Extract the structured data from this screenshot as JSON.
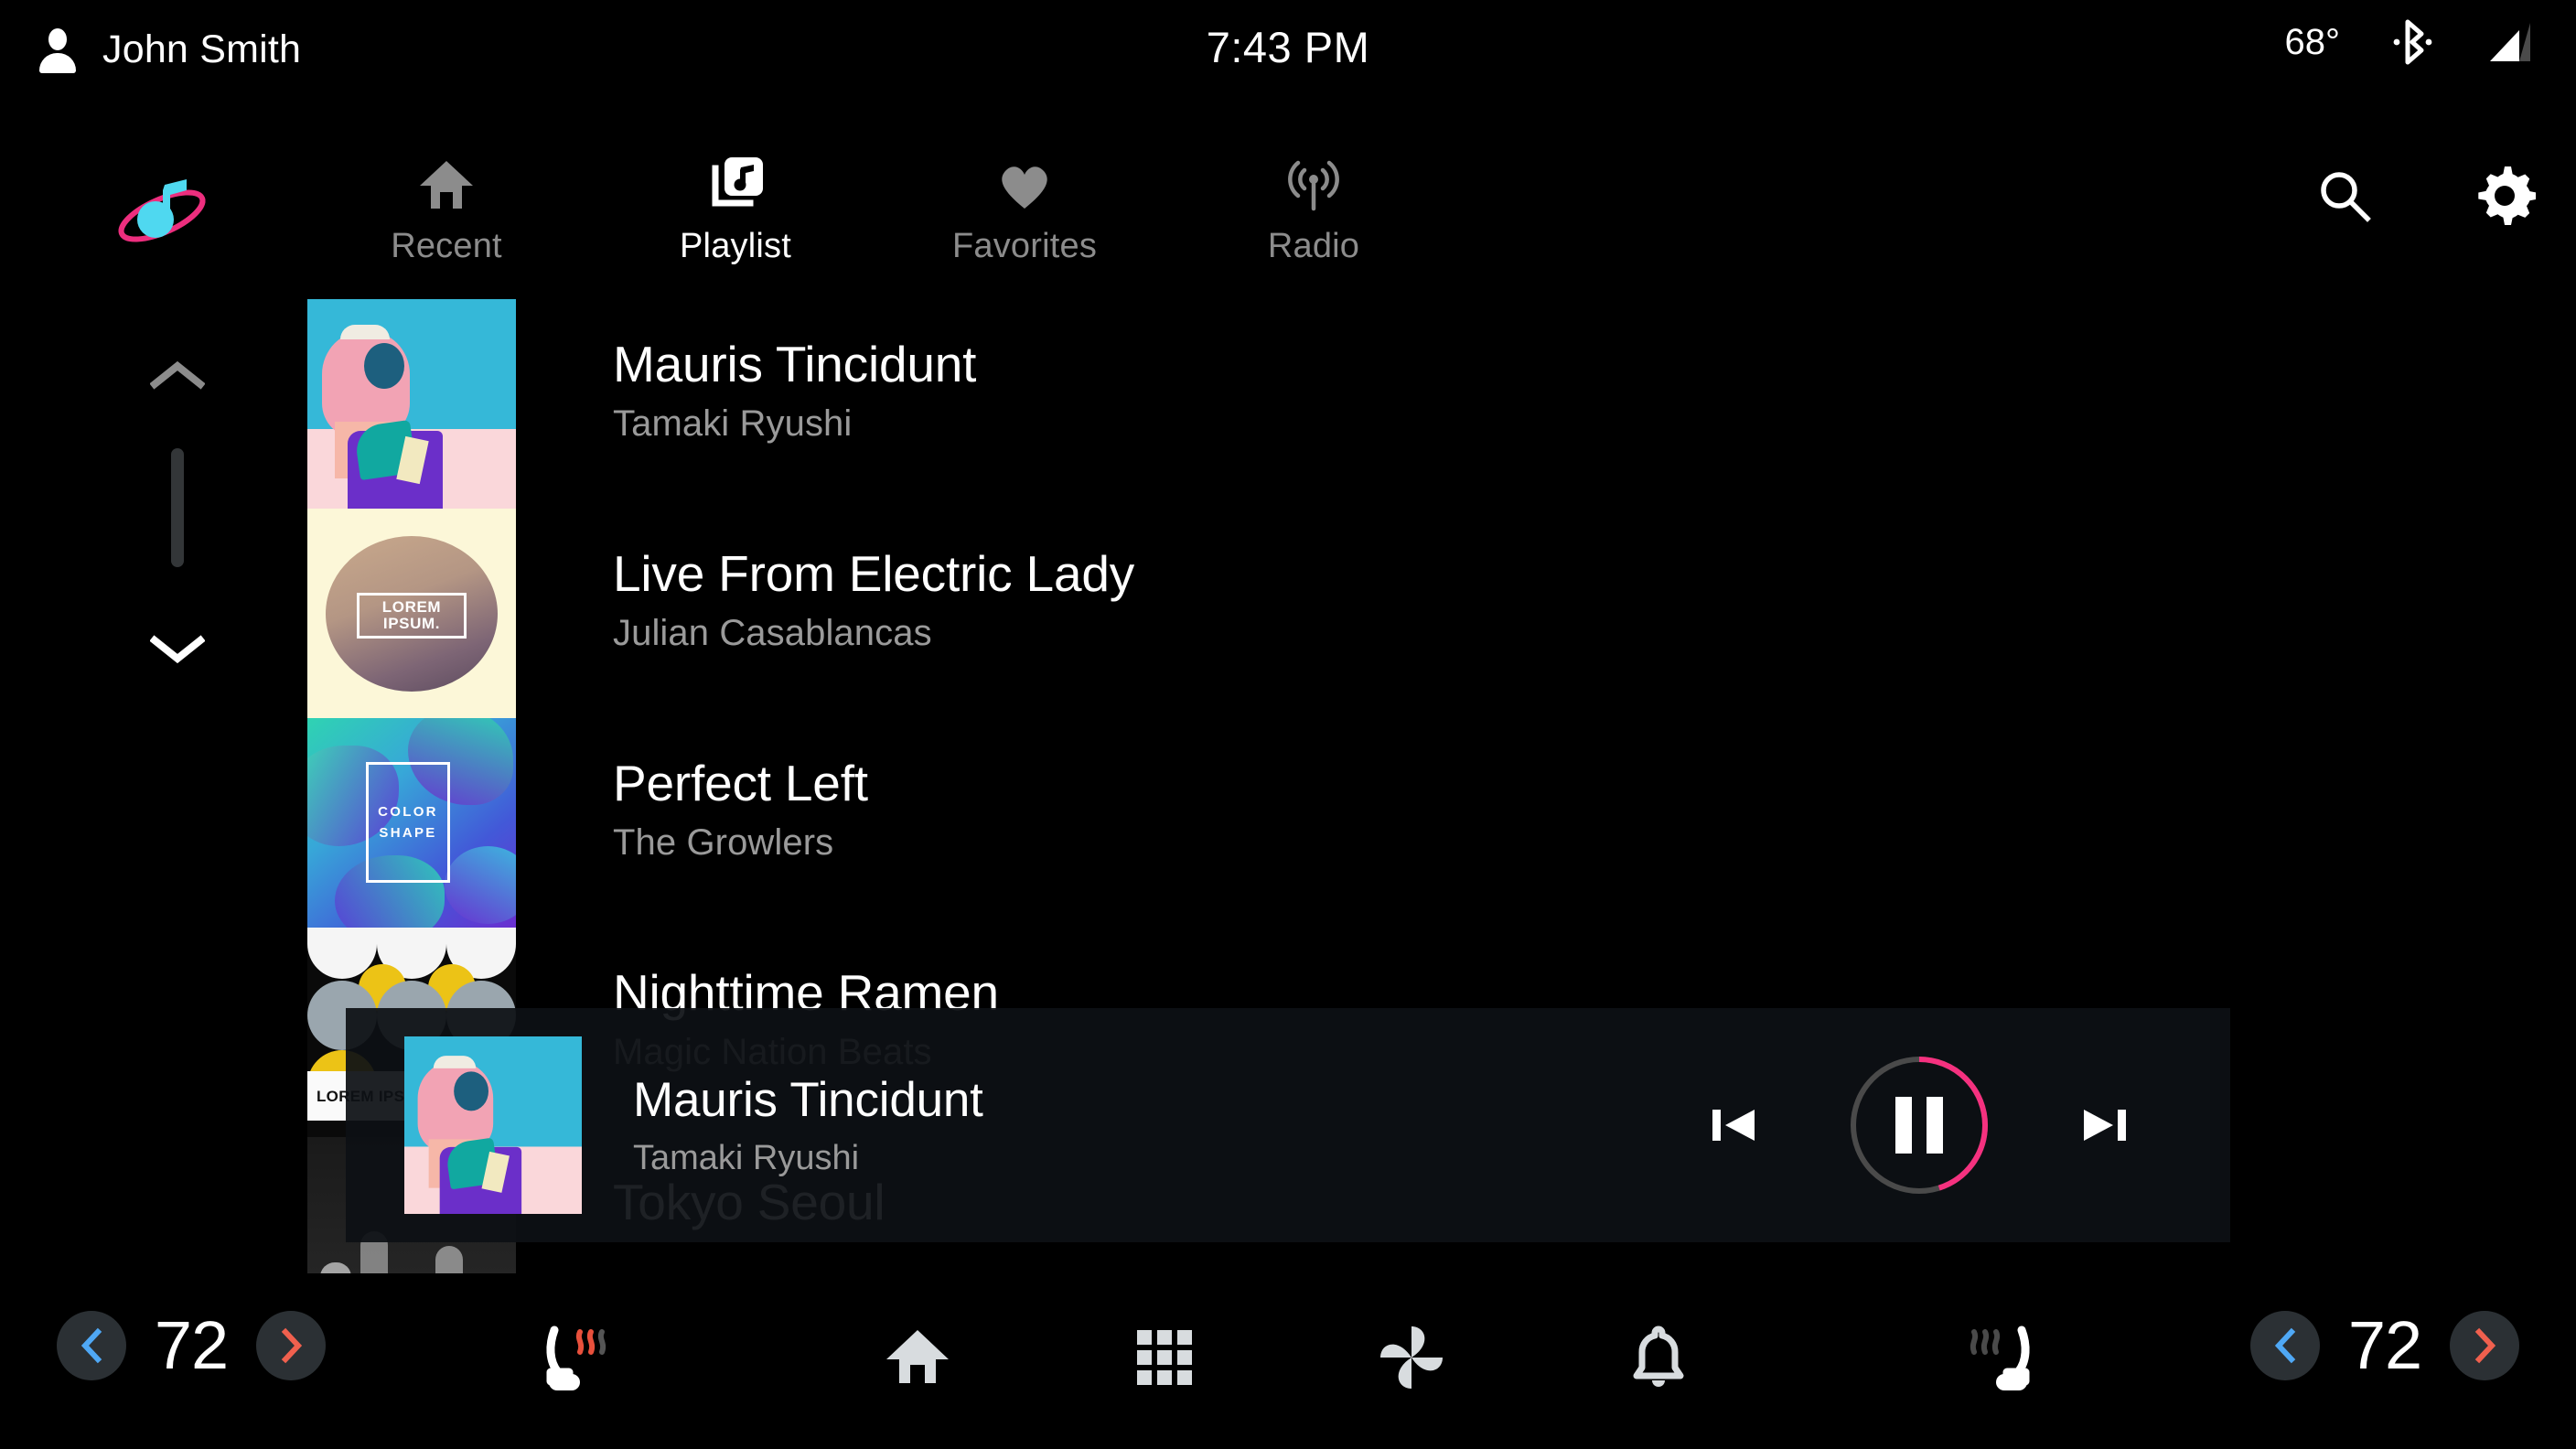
{
  "status_bar": {
    "user_name": "John Smith",
    "user_icon": "person-icon",
    "time": "7:43 PM",
    "temperature": "68°",
    "bluetooth_icon": "bluetooth-icon",
    "signal_icon": "cellular-signal-icon"
  },
  "app_bar": {
    "logo_icon": "music-planet-logo-icon",
    "tabs": [
      {
        "label": "Recent",
        "icon": "home-icon",
        "active": false
      },
      {
        "label": "Playlist",
        "icon": "playlist-icon",
        "active": true
      },
      {
        "label": "Favorites",
        "icon": "heart-icon",
        "active": false
      },
      {
        "label": "Radio",
        "icon": "radio-icon",
        "active": false
      }
    ],
    "search_icon": "search-icon",
    "settings_icon": "gear-icon"
  },
  "scroll": {
    "up_icon": "chevron-up-icon",
    "down_icon": "chevron-down-icon"
  },
  "tracks": [
    {
      "title": "Mauris Tincidunt",
      "artist": "Tamaki Ryushi",
      "art": "art-pink"
    },
    {
      "title": "Live From Electric Lady",
      "artist": "Julian Casablancas",
      "art": "art-cream",
      "art_text": "LOREM\nIPSUM."
    },
    {
      "title": "Perfect Left",
      "artist": "The Growlers",
      "art": "art-blob",
      "art_text": "COLOR\nSHAPE"
    },
    {
      "title": "Nighttime Ramen",
      "artist": "Magic Nation Beats",
      "art": "art-semi",
      "art_text": "LOREM IPSUM."
    },
    {
      "title": "Tokyo Seoul",
      "artist": "",
      "art": "art-crowd"
    }
  ],
  "now_playing": {
    "title": "Mauris Tincidunt",
    "artist": "Tamaki Ryushi",
    "prev_icon": "skip-previous-icon",
    "play_state_icon": "pause-icon",
    "next_icon": "skip-next-icon",
    "progress_percent": 45,
    "progress_color": "#F5317F",
    "track_ring_color": "#4A4A4A"
  },
  "bottom_bar": {
    "left_climate": {
      "decrease_icon": "chevron-left-icon",
      "temp": "72",
      "increase_icon": "chevron-right-icon"
    },
    "right_climate": {
      "decrease_icon": "chevron-left-icon",
      "temp": "72",
      "increase_icon": "chevron-right-icon"
    },
    "left_seat_icon": "heated-seat-icon",
    "right_seat_icon": "heated-seat-icon",
    "nav_items": [
      {
        "icon": "home-icon"
      },
      {
        "icon": "apps-grid-icon"
      },
      {
        "icon": "fan-climate-icon"
      },
      {
        "icon": "bell-notifications-icon"
      }
    ]
  },
  "colors": {
    "background": "#000000",
    "accent_pink": "#F5317F",
    "inactive_gray": "#8C8C8C",
    "icon_gray": "#D8DCDF",
    "cool_blue": "#4FA8F5",
    "warm_red": "#F0604E",
    "chip_dark": "#2B3034"
  }
}
